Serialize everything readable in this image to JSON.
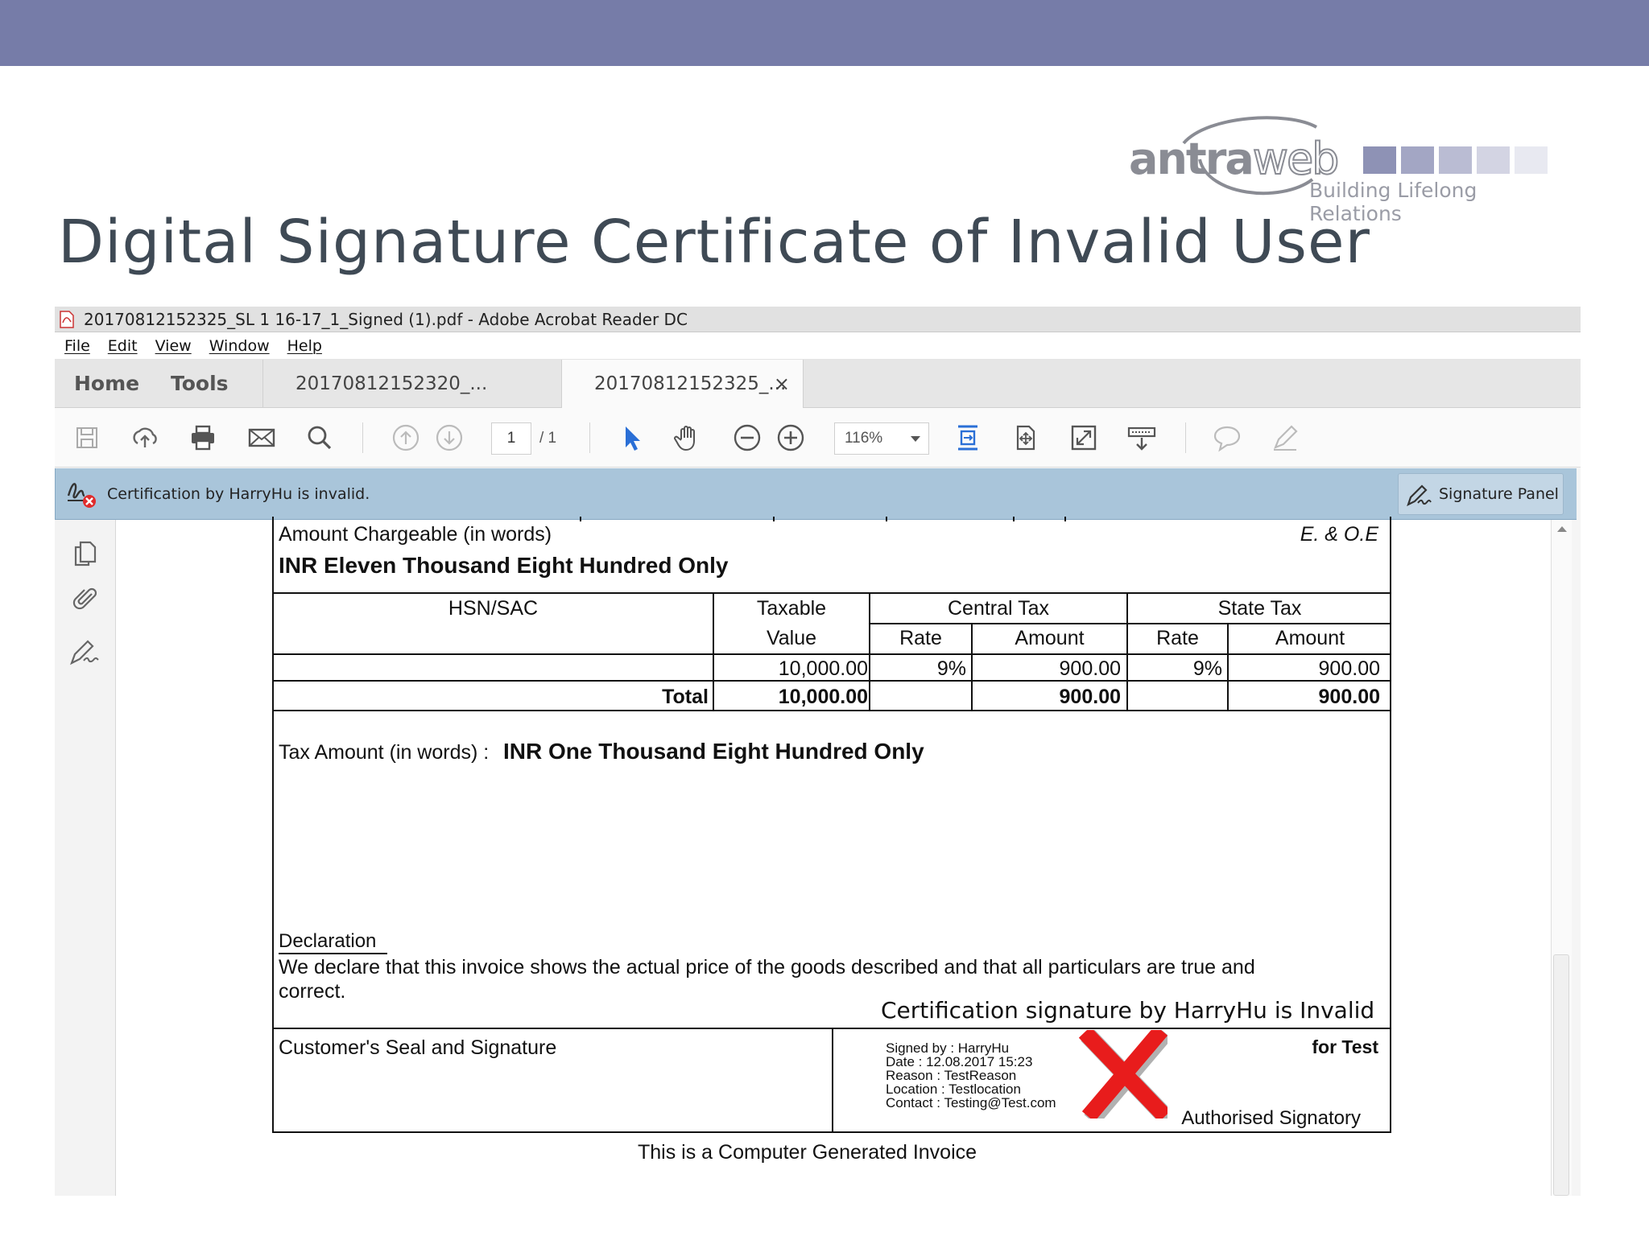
{
  "slide": {
    "title": "Digital Signature Certificate of Invalid User",
    "logo": {
      "name_solid": "antra",
      "name_outline": "web",
      "tagline": "Building Lifelong Relations",
      "square_colors": [
        "#8e92b5",
        "#a3a6c4",
        "#babcd3",
        "#d3d4e3",
        "#e8e9f1"
      ]
    },
    "colors": {
      "top_bar": "#767ca8",
      "title_text": "#3f4a55"
    }
  },
  "window": {
    "title": "20170812152325_SL 1 16-17_1_Signed (1).pdf - Adobe Acrobat Reader DC",
    "menu": [
      "File",
      "Edit",
      "View",
      "Window",
      "Help"
    ],
    "nav_tabs": {
      "home": "Home",
      "tools": "Tools"
    },
    "doc_tabs": [
      "20170812152320_...",
      "20170812152325_..."
    ],
    "tab_close": "×",
    "toolbar": {
      "icons": [
        "save-icon",
        "upload-icon",
        "print-icon",
        "email-icon",
        "search-icon",
        "prev-page-icon",
        "next-page-icon",
        "select-pointer-icon",
        "hand-icon",
        "zoom-out-icon",
        "zoom-in-icon",
        "fit-page-icon",
        "rotate-icon",
        "fullscreen-icon",
        "read-mode-icon",
        "comment-icon",
        "sign-pen-icon"
      ],
      "page_current": "1",
      "page_total": "/ 1",
      "zoom": "116%"
    },
    "signature_bar": {
      "message": "Certification by HarryHu is invalid.",
      "panel_button": "Signature Panel"
    },
    "left_rail_icons": [
      "pages-icon",
      "attachments-icon",
      "signatures-icon"
    ]
  },
  "invoice": {
    "amount_label": "Amount Chargeable (in words)",
    "eoe": "E. & O.E",
    "amount_words": "INR Eleven Thousand Eight Hundred Only",
    "headers": {
      "hsn": "HSN/SAC",
      "taxable_1": "Taxable",
      "taxable_2": "Value",
      "central_tax": "Central Tax",
      "state_tax": "State Tax",
      "rate": "Rate",
      "amount": "Amount"
    },
    "row": {
      "hsn": "",
      "taxable": "10,000.00",
      "central_rate": "9%",
      "central_amount": "900.00",
      "state_rate": "9%",
      "state_amount": "900.00"
    },
    "total": {
      "label": "Total",
      "taxable": "10,000.00",
      "central_amount": "900.00",
      "state_amount": "900.00"
    },
    "tax_words_label": "Tax Amount (in words)  :",
    "tax_words": "INR One Thousand Eight Hundred Only",
    "declaration_label": "Declaration",
    "declaration_line1": "We declare that this invoice shows the actual price of the goods described and that all particulars are true and",
    "declaration_line2": "correct.",
    "cert_invalid": "Certification signature by HarryHu is Invalid",
    "customer_seal": "Customer's Seal and Signature",
    "signed_details": [
      "Signed by : HarryHu",
      "Date : 12.08.2017 15:23",
      "Reason : TestReason",
      "Location : Testlocation",
      "Contact : Testing@Test.com"
    ],
    "for_company": "for Test",
    "authorised": "Authorised Signatory",
    "footer": "This is a Computer Generated Invoice"
  }
}
